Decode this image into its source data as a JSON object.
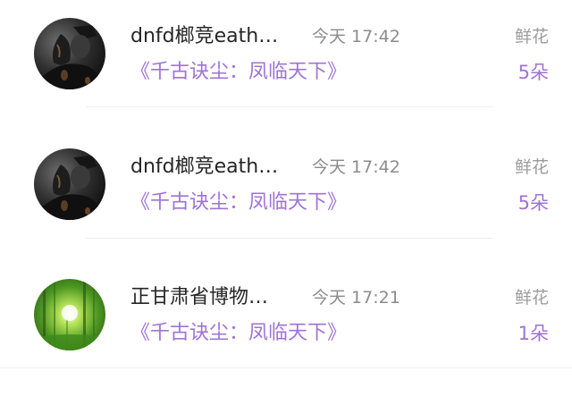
{
  "colors": {
    "accent_purple": "#9f73d6",
    "name_text": "#262626",
    "meta_text": "#8c8c8c",
    "divider": "#f0f0f0"
  },
  "items": [
    {
      "avatar_icon": "dark-portrait-avatar",
      "name": "dnfd榔竞eath…",
      "time": "今天 17:42",
      "gift_label": "鲜花",
      "book_title": "《千古诀尘：凤临天下》",
      "count": "5朵"
    },
    {
      "avatar_icon": "dark-portrait-avatar",
      "name": "dnfd榔竞eath…",
      "time": "今天 17:42",
      "gift_label": "鲜花",
      "book_title": "《千古诀尘：凤临天下》",
      "count": "5朵"
    },
    {
      "avatar_icon": "green-forest-avatar",
      "name": "正甘肃省博物…",
      "time": "今天 17:21",
      "gift_label": "鲜花",
      "book_title": "《千古诀尘：凤临天下》",
      "count": "1朵"
    }
  ]
}
